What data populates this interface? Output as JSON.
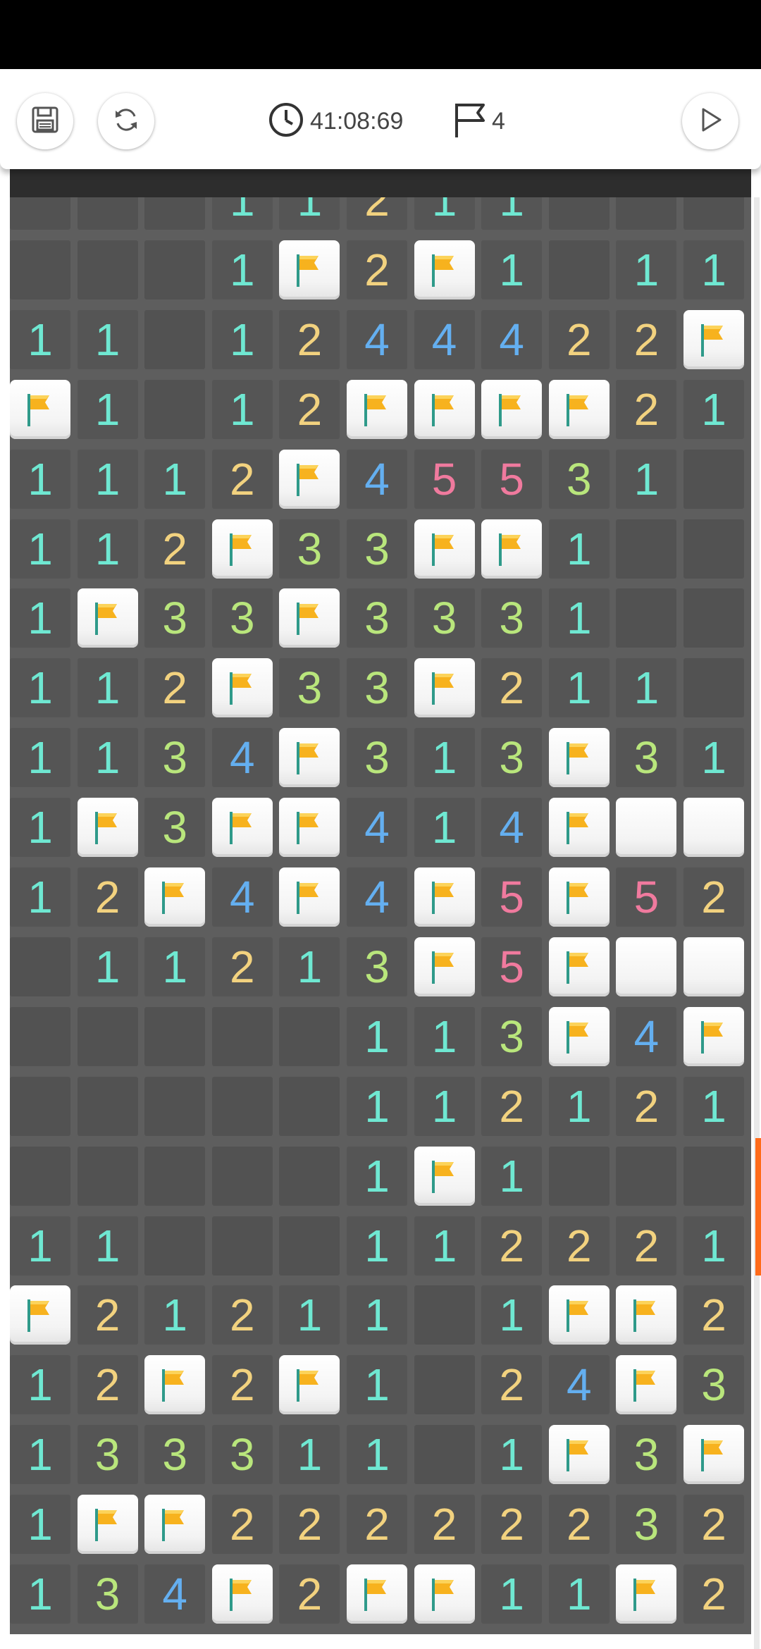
{
  "toolbar": {
    "timer": "41:08:69",
    "flag_count": "4",
    "icons": [
      "save-icon",
      "restart-icon",
      "clock-icon",
      "flag-counter-icon",
      "play-icon"
    ]
  },
  "board": {
    "columns": 11,
    "legend": "0 = revealed empty, 1-5 = revealed number, F = flagged, H = unrevealed",
    "rows": [
      [
        "0",
        "0",
        "0",
        "1",
        "1",
        "2",
        "1",
        "1",
        "0",
        "0",
        "0"
      ],
      [
        "0",
        "0",
        "0",
        "1",
        "F",
        "2",
        "F",
        "1",
        "0",
        "1",
        "1"
      ],
      [
        "1",
        "1",
        "0",
        "1",
        "2",
        "4",
        "4",
        "4",
        "2",
        "2",
        "F"
      ],
      [
        "F",
        "1",
        "0",
        "1",
        "2",
        "F",
        "F",
        "F",
        "F",
        "2",
        "1"
      ],
      [
        "1",
        "1",
        "1",
        "2",
        "F",
        "4",
        "5",
        "5",
        "3",
        "1",
        "0"
      ],
      [
        "1",
        "1",
        "2",
        "F",
        "3",
        "3",
        "F",
        "F",
        "1",
        "0",
        "0"
      ],
      [
        "1",
        "F",
        "3",
        "3",
        "F",
        "3",
        "3",
        "3",
        "1",
        "0",
        "0"
      ],
      [
        "1",
        "1",
        "2",
        "F",
        "3",
        "3",
        "F",
        "2",
        "1",
        "1",
        "0"
      ],
      [
        "1",
        "1",
        "3",
        "4",
        "F",
        "3",
        "1",
        "3",
        "F",
        "3",
        "1"
      ],
      [
        "1",
        "F",
        "3",
        "F",
        "F",
        "4",
        "1",
        "4",
        "F",
        "H",
        "H"
      ],
      [
        "1",
        "2",
        "F",
        "4",
        "F",
        "4",
        "F",
        "5",
        "F",
        "5",
        "2"
      ],
      [
        "0",
        "1",
        "1",
        "2",
        "1",
        "3",
        "F",
        "5",
        "F",
        "H",
        "H"
      ],
      [
        "0",
        "0",
        "0",
        "0",
        "0",
        "1",
        "1",
        "3",
        "F",
        "4",
        "F"
      ],
      [
        "0",
        "0",
        "0",
        "0",
        "0",
        "1",
        "1",
        "2",
        "1",
        "2",
        "1"
      ],
      [
        "0",
        "0",
        "0",
        "0",
        "0",
        "1",
        "F",
        "1",
        "0",
        "0",
        "0"
      ],
      [
        "1",
        "1",
        "0",
        "0",
        "0",
        "1",
        "1",
        "2",
        "2",
        "2",
        "1"
      ],
      [
        "F",
        "2",
        "1",
        "2",
        "1",
        "1",
        "0",
        "1",
        "F",
        "F",
        "2"
      ],
      [
        "1",
        "2",
        "F",
        "2",
        "F",
        "1",
        "0",
        "2",
        "4",
        "F",
        "3"
      ],
      [
        "1",
        "3",
        "3",
        "3",
        "1",
        "1",
        "0",
        "1",
        "F",
        "3",
        "F"
      ],
      [
        "1",
        "F",
        "F",
        "2",
        "2",
        "2",
        "2",
        "2",
        "2",
        "3",
        "2"
      ],
      [
        "1",
        "3",
        "4",
        "F",
        "2",
        "F",
        "F",
        "1",
        "1",
        "F",
        "2"
      ]
    ]
  },
  "colors": {
    "n1": "#6fe8d2",
    "n2": "#f2d27f",
    "n3": "#b9e67c",
    "n4": "#64aff0",
    "n5": "#f07a9e",
    "flag": "#f7b21e",
    "scroll_thumb": "#ff6b1a"
  }
}
